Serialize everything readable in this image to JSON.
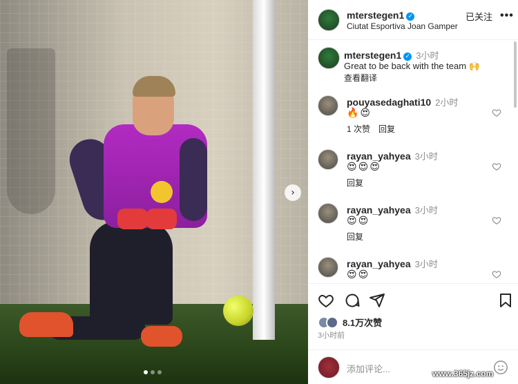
{
  "post": {
    "username": "mterstegen1",
    "location": "Ciutat Esportiva Joan Gamper",
    "follow_label": "已关注",
    "more_label": "•••",
    "caption": {
      "username": "mterstegen1",
      "time": "3小时",
      "text": "Great to be back with the team 🙌",
      "translate_label": "查看翻译"
    },
    "comments": [
      {
        "username": "pouyasedaghati10",
        "time": "2小时",
        "emoji": "🔥😍",
        "likes_label": "1 次赞",
        "reply_label": "回复"
      },
      {
        "username": "rayan_yahyea",
        "time": "3小时",
        "emoji": "😍😍😍",
        "reply_label": "回复"
      },
      {
        "username": "rayan_yahyea",
        "time": "3小时",
        "emoji": "😍😍",
        "reply_label": "回复"
      },
      {
        "username": "rayan_yahyea",
        "time": "3小时",
        "emoji": "😍😍"
      }
    ],
    "likes": "8.1万次赞",
    "posted": "3小时前",
    "add_comment_placeholder": "添加评论...",
    "carousel": {
      "current": 1,
      "total": 3
    }
  },
  "icons": {
    "heart": "heart-icon",
    "comment": "comment-icon",
    "share": "share-icon",
    "save": "bookmark-icon",
    "emoji": "emoji-icon",
    "next": "chevron-right-icon"
  },
  "watermark": "www.365jz.com",
  "colors": {
    "verified": "#0095f6",
    "muted": "#8e8e8e",
    "text": "#262626"
  }
}
